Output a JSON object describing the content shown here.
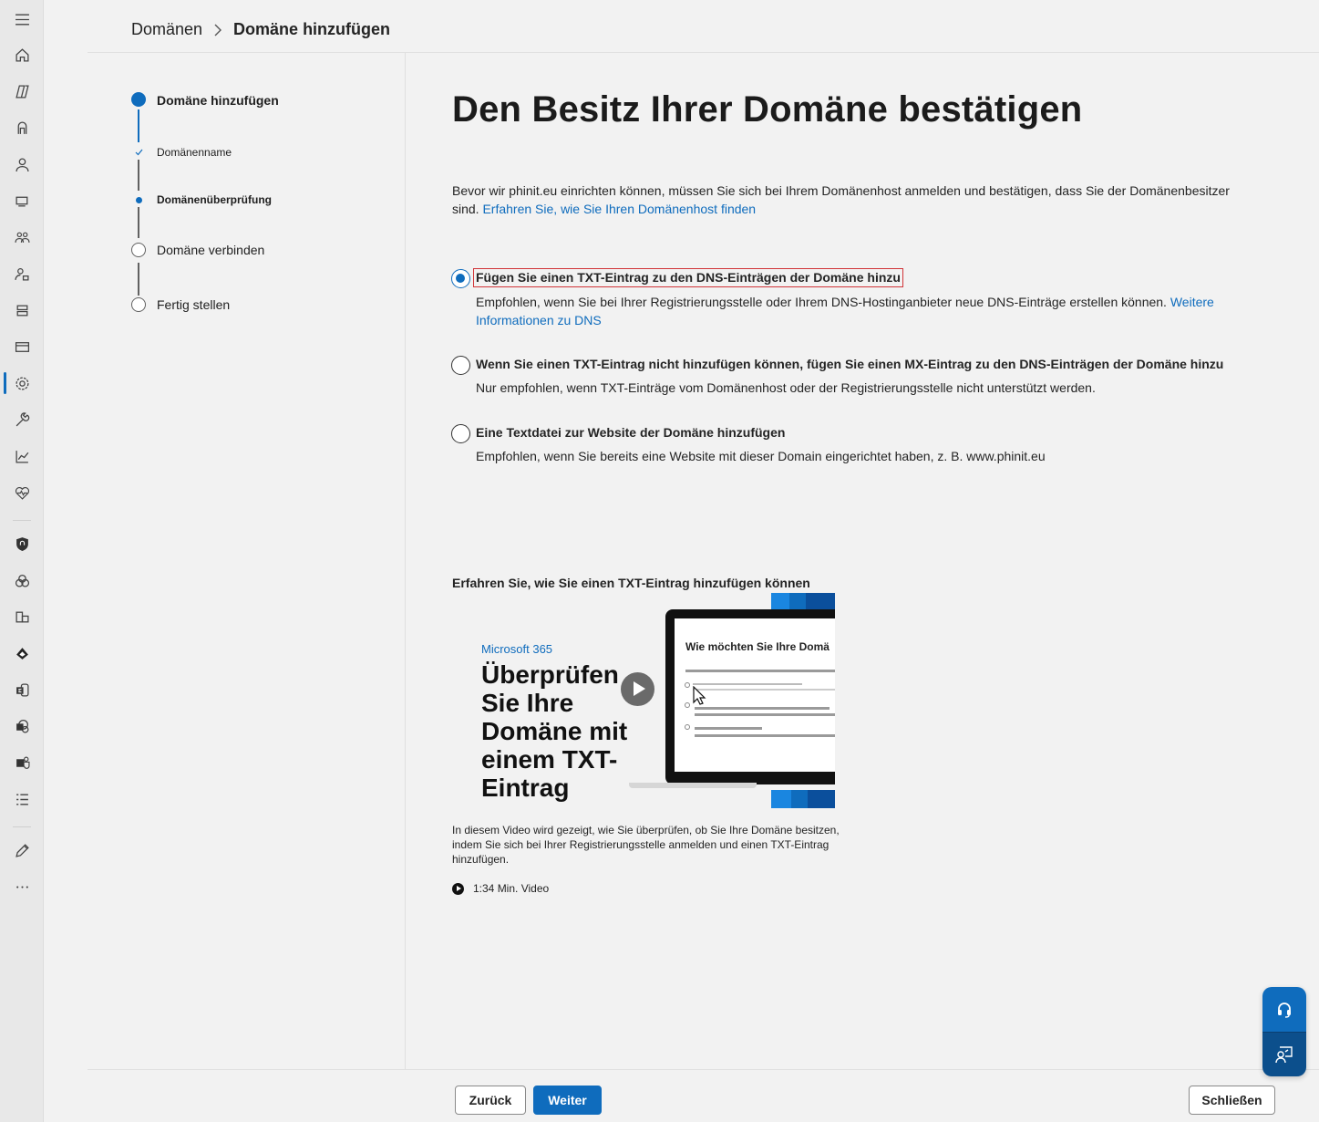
{
  "breadcrumb": {
    "parent": "Domänen",
    "current": "Domäne hinzufügen"
  },
  "stepper": {
    "steps": [
      {
        "label": "Domäne hinzufügen",
        "state": "current-main"
      },
      {
        "label": "Domänenname",
        "state": "done-sub"
      },
      {
        "label": "Domänenüberprüfung",
        "state": "current-sub"
      },
      {
        "label": "Domäne verbinden",
        "state": "pending"
      },
      {
        "label": "Fertig stellen",
        "state": "pending"
      }
    ]
  },
  "main": {
    "title": "Den Besitz Ihrer Domäne bestätigen",
    "intro_text": "Bevor wir phinit.eu einrichten können, müssen Sie sich bei Ihrem Domänenhost anmelden und bestätigen, dass Sie der Domänenbesitzer sind.",
    "intro_link": "Erfahren Sie, wie Sie Ihren Domänenhost finden",
    "options": [
      {
        "title": "Fügen Sie einen TXT-Eintrag zu den DNS-Einträgen der Domäne hinzu",
        "desc": "Empfohlen, wenn Sie bei Ihrer Registrierungsstelle oder Ihrem DNS-Hostinganbieter neue DNS-Einträge erstellen können.",
        "link": "Weitere Informationen zu DNS",
        "selected": true
      },
      {
        "title": "Wenn Sie einen TXT-Eintrag nicht hinzufügen können, fügen Sie einen MX-Eintrag zu den DNS-Einträgen der Domäne hinzu",
        "desc": "Nur empfohlen, wenn TXT-Einträge vom Domänenhost oder der Registrierungsstelle nicht unterstützt werden.",
        "selected": false
      },
      {
        "title": "Eine Textdatei zur Website der Domäne hinzufügen",
        "desc": "Empfohlen, wenn Sie bereits eine Website mit dieser Domain eingerichtet haben, z. B. www.phinit.eu",
        "selected": false
      }
    ]
  },
  "video": {
    "heading": "Erfahren Sie, wie Sie einen TXT-Eintrag hinzufügen können",
    "thumb_brand": "Microsoft 365",
    "thumb_headline": "Überprüfen Sie Ihre Domäne mit einem TXT-Eintrag",
    "thumb_screen_title": "Wie möchten Sie Ihre Domä",
    "description": "In diesem Video wird gezeigt, wie Sie überprüfen, ob Sie Ihre Domäne besitzen, indem Sie sich bei Ihrer Registrierungsstelle anmelden und einen TXT-Eintrag hinzufügen.",
    "duration": "1:34 Min. Video"
  },
  "footer": {
    "back_label": "Zurück",
    "next_label": "Weiter",
    "close_label": "Schließen"
  },
  "colors": {
    "accent": "#0f6cbd",
    "focus_outline": "#d13438"
  },
  "rail_icons": [
    "menu-icon",
    "home-icon",
    "copilot-icon",
    "copilot-app-icon",
    "user-icon",
    "devices-icon",
    "groups-icon",
    "roles-icon",
    "resources-icon",
    "billing-icon",
    "settings-icon",
    "setup-icon",
    "reports-icon",
    "health-icon",
    "security-icon",
    "compliance-icon",
    "endpoint-icon",
    "azure-ad-icon",
    "exchange-icon",
    "sharepoint-icon",
    "teams-icon",
    "all-admin-centers-icon",
    "customize-icon",
    "more-icon"
  ]
}
